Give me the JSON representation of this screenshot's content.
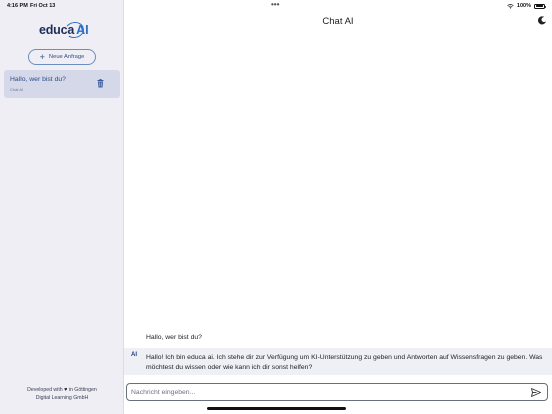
{
  "status_bar": {
    "time": "4:16 PM",
    "date": "Fri Oct 13",
    "battery": "100%",
    "dots": "•••"
  },
  "sidebar": {
    "logo_text": "educa",
    "logo_ai": "AI",
    "new_request_label": "Neue Anfrage",
    "chats": [
      {
        "title": "Hallo, wer bist du?",
        "subtitle": "Chat AI"
      }
    ],
    "footer_line1_pre": "Developed with",
    "footer_line1_post": "in Göttingen",
    "footer_line2": "Digital Learning GmbH"
  },
  "main": {
    "title": "Chat AI",
    "messages": [
      {
        "role": "user",
        "text": "Hallo, wer bist du?"
      },
      {
        "role": "assistant",
        "avatar": "AI",
        "text": "Hallo! Ich bin educa ai. Ich stehe dir zur Verfügung um KI-Unterstützung zu geben und Antworten auf Wissensfragen zu geben. Was möchtest du wissen oder wie kann ich dir sonst helfen?"
      }
    ],
    "input_placeholder": "Nachricht eingeben...",
    "input_value": ""
  },
  "colors": {
    "accent": "#2a6ec6",
    "sidebar_bg": "#eeeef4",
    "selected_chat_bg": "#d4d8e8"
  },
  "icons": [
    "wifi-icon",
    "battery-icon",
    "plus-icon",
    "trash-icon",
    "heart-icon",
    "moon-icon",
    "send-icon"
  ]
}
